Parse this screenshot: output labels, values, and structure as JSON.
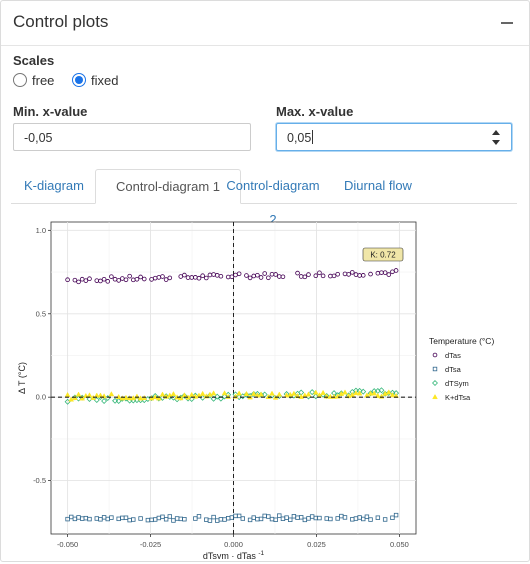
{
  "panel": {
    "title": "Control plots"
  },
  "scales": {
    "label": "Scales",
    "options": [
      {
        "label": "free",
        "selected": false
      },
      {
        "label": "fixed",
        "selected": true
      }
    ]
  },
  "min_x": {
    "label": "Min. x-value",
    "value": "-0,05"
  },
  "max_x": {
    "label": "Max. x-value",
    "value": "0,05"
  },
  "tabs": [
    {
      "label": "K-diagram",
      "active": false
    },
    {
      "label": "Control-diagram 1",
      "active": true
    },
    {
      "label": "Control-diagram 2",
      "active": false
    },
    {
      "label": "Diurnal flow",
      "active": false
    }
  ],
  "chart_data": {
    "type": "scatter",
    "xlabel": "dTsym · dTas",
    "xlabel_sup": "-1",
    "ylabel": "Δ T (°C)",
    "xlim": [
      -0.055,
      0.055
    ],
    "ylim": [
      -0.82,
      1.05
    ],
    "x_ticks": [
      -0.05,
      -0.025,
      0.0,
      0.025,
      0.05
    ],
    "x_tick_labels": [
      "-0.050",
      "-0.025",
      "0.000",
      "0.025",
      "0.050"
    ],
    "y_ticks": [
      -0.5,
      0.0,
      0.5,
      1.0
    ],
    "y_tick_labels": [
      "-0.5",
      "0.0",
      "0.5",
      "1.0"
    ],
    "vline_x": 0.0,
    "hline_y": 0.0,
    "annotation": "K:  0.72",
    "legend": {
      "title": "Temperature (°C)",
      "position": "right"
    },
    "series": [
      {
        "name": "dTas",
        "color": "#440154",
        "marker": "circle",
        "y_start": 0.7,
        "y_end": 0.75
      },
      {
        "name": "dTsa",
        "color": "#31688e",
        "marker": "square",
        "y_start": -0.73,
        "y_end": -0.72
      },
      {
        "name": "dTSym",
        "color": "#35b779",
        "marker": "diamond",
        "y_start": -0.02,
        "y_end": 0.035
      },
      {
        "name": "K+dTsa",
        "color": "#fde725",
        "marker": "triangle",
        "y_start": 0.0,
        "y_end": 0.02
      }
    ]
  }
}
